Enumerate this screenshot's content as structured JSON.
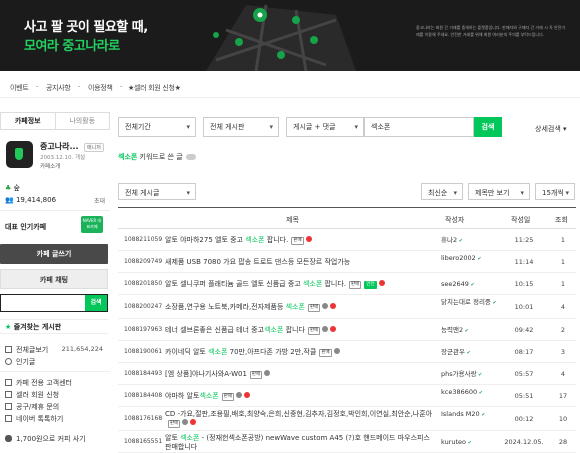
{
  "banner": {
    "line1": "사고 팔 곳이 필요할 때,",
    "line2": "모여라 중고나라로",
    "small_text": "(Heading text in the small dark banner, too small to read.)"
  },
  "topnav": {
    "items": [
      "이벤트",
      "공지사항",
      "이용정책",
      "★셀러 회원 신청★"
    ]
  },
  "sidebar": {
    "tabs": [
      "카페정보",
      "나의활동"
    ],
    "cafe_name": "중고나라...",
    "manager_label": "매니저",
    "since": "2003.12.10. 개설",
    "intro": "카페소개",
    "level": "숲",
    "members": "19,414,806",
    "invite": "초대",
    "popular": "대표 인기카페",
    "naver_badge": "NAVER 대표카페",
    "write_button": "카페 글쓰기",
    "chat_button": "카페 채팅",
    "search_button": "검색",
    "favorites_title": "즐겨찾는 게시판",
    "menu1": [
      {
        "label": "전체글보기",
        "count": "211,654,224"
      },
      {
        "label": "인기글",
        "count": ""
      }
    ],
    "menu2": [
      {
        "label": "카페 전용 고객센터"
      },
      {
        "label": "셀러 회원 신청"
      },
      {
        "label": "공구/제휴 문의"
      },
      {
        "label": "네이버 톡톡하기"
      }
    ],
    "bottom": "1,700원으로 커피 사기"
  },
  "search": {
    "period": "전체기간",
    "board": "전체 게시판",
    "scope": "게시글 + 댓글",
    "query": "섹소폰",
    "button": "검색",
    "advanced": "상세검색"
  },
  "keyword_row": {
    "keyword": "섹소폰",
    "suffix": " 키워드로 쓴 글"
  },
  "list_controls": {
    "board_filter": "전체 게시글",
    "sort": "최신순",
    "view": "제목만 보기",
    "per_page": "15개씩"
  },
  "table": {
    "headers": {
      "title": "제목",
      "author": "작성자",
      "date": "작성일",
      "views": "조회"
    },
    "rows": [
      {
        "no": "1088211059",
        "pre": "알토 야마하275 엘토 중고 ",
        "hl": "섹소폰",
        "post": " 팝니다.",
        "tags": [
          "판매"
        ],
        "icons": [
          "rc"
        ],
        "comments": "",
        "author": "휴나2",
        "date": "11:25",
        "views": "1"
      },
      {
        "no": "1088209749",
        "pre": "새제품 USB 7080 가요 팝송 트로트 댄스등 모든장르 작업가능",
        "hl": "",
        "post": "",
        "tags": [],
        "icons": [],
        "comments": "",
        "author": "libero2002",
        "date": "11:14",
        "views": "1"
      },
      {
        "no": "1088201850",
        "pre": "알토 셀니쿠퍼 플래티늄 골드 엘토 신품급 중고 ",
        "hl": "섹소폰",
        "post": " 팝니다.",
        "tags": [
          "판매",
          "안전"
        ],
        "icons": [
          "rc"
        ],
        "comments": "",
        "author": "see2649",
        "date": "10:15",
        "views": "1"
      },
      {
        "no": "1088200247",
        "pre": "소장품,연구용 노트북,카메라,전자제품등 ",
        "hl": "섹소폰",
        "post": "",
        "tags": [
          "판매"
        ],
        "icons": [
          "img",
          "rc"
        ],
        "comments": "",
        "author": "닭치는대로 정리중",
        "date": "10:01",
        "views": "4"
      },
      {
        "no": "1088197963",
        "pre": "테너 셀브론좋은 신품급 테너 중고",
        "hl": "섹소폰",
        "post": " 팝니다",
        "tags": [
          "판매"
        ],
        "icons": [
          "img",
          "rc"
        ],
        "comments": "",
        "author": "능력맨2",
        "date": "09:42",
        "views": "2"
      },
      {
        "no": "1088190061",
        "pre": "카이네딕 알토 ",
        "hl": "섹소폰",
        "post": " 70만,아프다존 가방 2만,작클",
        "tags": [
          "판매"
        ],
        "icons": [
          "img"
        ],
        "comments": "",
        "author": "장군관우",
        "date": "08:17",
        "views": "3"
      },
      {
        "no": "1088184493",
        "pre": "[엠 상품]야나기사와A-W01",
        "hl": "",
        "post": "",
        "tags": [
          "판매"
        ],
        "icons": [
          "img"
        ],
        "comments": "",
        "author": "phs가용사랑",
        "date": "05:57",
        "views": "4"
      },
      {
        "no": "1088184408",
        "pre": "야마하 알토",
        "hl": "섹소폰",
        "post": "",
        "tags": [
          "판매"
        ],
        "icons": [
          "img",
          "rc"
        ],
        "comments": "",
        "author": "kce386600",
        "date": "05:51",
        "views": "17"
      },
      {
        "no": "1088176168",
        "pre": "CD -가요,절판,조용필,배호,최양숙,은희,신중현,김추자,김정호,박인희,이연실,최안순,나훈아",
        "hl": "",
        "post": "",
        "tags": [
          "판매"
        ],
        "icons": [
          "img",
          "rc"
        ],
        "comments": "",
        "author": "Islands M20",
        "date": "00:12",
        "views": "10"
      },
      {
        "no": "1088165551",
        "pre": "알토 ",
        "hl": "섹소폰",
        "post": " - (정재헌섹소폰공방) newWave custom A45 (?)호 핸드메이드 마우스피스 판매합니다",
        "tags": [],
        "icons": [],
        "comments": "",
        "author": "kuruteo",
        "date": "2024.12.05.",
        "views": "28"
      }
    ]
  }
}
